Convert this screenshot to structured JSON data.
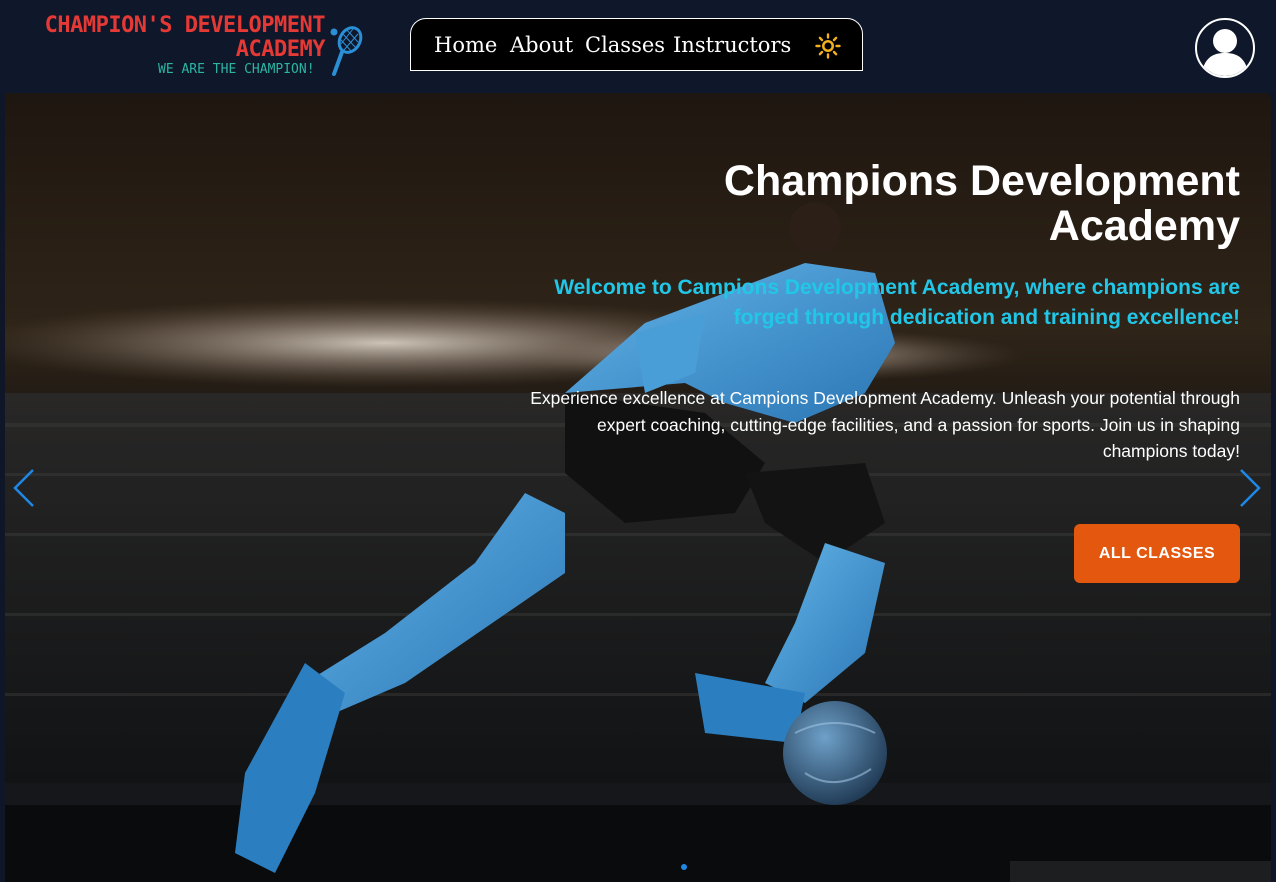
{
  "brand": {
    "title_line1": "CHAMPION'S DEVELOPMENT",
    "title_line2": "ACADEMY",
    "tagline": "WE ARE THE CHAMPION!",
    "title_color": "#e53935",
    "tagline_color": "#2bb5a3"
  },
  "nav": {
    "items": [
      {
        "label": "Home"
      },
      {
        "label": "About"
      },
      {
        "label": "Classes"
      },
      {
        "label": "Instructors"
      }
    ],
    "theme_toggle_icon": "sun-icon",
    "profile_icon": "user-avatar-icon"
  },
  "hero": {
    "title": "Champions Development Academy",
    "subtitle": "Welcome to Campions Development Academy, where champions are forged through dedication and training excellence!",
    "description": "Experience excellence at Campions Development Academy. Unleash your potential through expert coaching, cutting-edge facilities, and a passion for sports. Join us in shaping champions today!",
    "cta_label": "ALL CLASSES",
    "prev_icon": "chevron-left-icon",
    "next_icon": "chevron-right-icon",
    "background_image": "soccer-player-kicking-ball-stadium"
  },
  "colors": {
    "navbar": "#0f172a",
    "accent_cyan": "#22c7e8",
    "cta_orange": "#e4570f",
    "sun_yellow": "#f2b01e",
    "indicator_blue": "#1e88e5"
  }
}
